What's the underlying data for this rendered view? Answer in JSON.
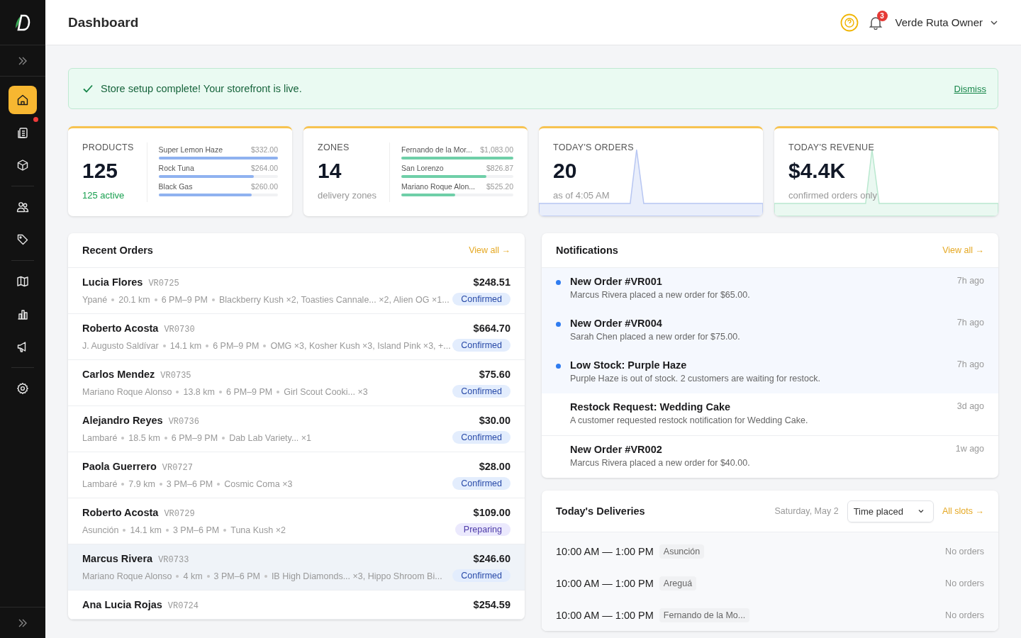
{
  "sidebar": {
    "items": [
      {
        "selected": true,
        "dot": false
      },
      {
        "selected": false,
        "dot": true
      },
      {
        "selected": false,
        "dot": false
      },
      {
        "selected": false,
        "dot": false
      },
      {
        "selected": false,
        "dot": false
      },
      {
        "selected": false,
        "dot": false
      },
      {
        "selected": false,
        "dot": false
      },
      {
        "selected": false,
        "dot": false
      },
      {
        "selected": false,
        "dot": false
      }
    ]
  },
  "header": {
    "title": "Dashboard",
    "notification_count": "3",
    "user": "Verde Ruta Owner"
  },
  "banner": {
    "message": "Store setup complete! Your storefront is live.",
    "action": "Dismiss"
  },
  "stats": [
    {
      "kind": "bars",
      "label": "PRODUCTS",
      "value": "125",
      "sub": "125 active",
      "sub_accent": true,
      "bars": [
        {
          "name": "Super Lemon Haze",
          "amount": "$332.00",
          "level": 1.0
        },
        {
          "name": "Rock Tuna",
          "amount": "$264.00",
          "level": 0.8
        },
        {
          "name": "Black Gas",
          "amount": "$260.00",
          "level": 0.78
        }
      ]
    },
    {
      "kind": "bars",
      "label": "ZONES",
      "value": "14",
      "sub": "delivery zones",
      "sub_accent": false,
      "bars": [
        {
          "name": "Fernando de la Mor...",
          "amount": "$1,083.00",
          "level": 1.0
        },
        {
          "name": "San Lorenzo",
          "amount": "$826.87",
          "level": 0.76
        },
        {
          "name": "Mariano Roque Alon...",
          "amount": "$525.20",
          "level": 0.48
        }
      ]
    },
    {
      "kind": "spark",
      "label": "TODAY'S ORDERS",
      "value": "20",
      "sub": "as of 4:05 AM",
      "sub_accent": false
    },
    {
      "kind": "spark",
      "label": "TODAY'S REVENUE",
      "value": "$4.4K",
      "sub": "confirmed orders only",
      "sub_accent": false
    }
  ],
  "recent_orders": {
    "title": "Recent Orders",
    "link": "View all →",
    "rows": [
      {
        "name": "Lucia Flores",
        "code": "VR0725",
        "amount": "$248.51",
        "status": "Confirmed",
        "kind": "confirmed",
        "highlighted": false,
        "meta": [
          "Ypané",
          "20.1 km",
          "6 PM–9 PM",
          "Blackberry Kush ×2, Toasties Cannale... ×2, Alien OG ×1..."
        ]
      },
      {
        "name": "Roberto Acosta",
        "code": "VR0730",
        "amount": "$664.70",
        "status": "Confirmed",
        "kind": "confirmed",
        "highlighted": false,
        "meta": [
          "J. Augusto Saldívar",
          "14.1 km",
          "6 PM–9 PM",
          "OMG ×3, Kosher Kush ×3, Island Pink ×3, +..."
        ]
      },
      {
        "name": "Carlos Mendez",
        "code": "VR0735",
        "amount": "$75.60",
        "status": "Confirmed",
        "kind": "confirmed",
        "highlighted": false,
        "meta": [
          "Mariano Roque Alonso",
          "13.8 km",
          "6 PM–9 PM",
          "Girl Scout Cooki... ×3"
        ]
      },
      {
        "name": "Alejandro Reyes",
        "code": "VR0736",
        "amount": "$30.00",
        "status": "Confirmed",
        "kind": "confirmed",
        "highlighted": false,
        "meta": [
          "Lambaré",
          "18.5 km",
          "6 PM–9 PM",
          "Dab Lab Variety... ×1"
        ]
      },
      {
        "name": "Paola Guerrero",
        "code": "VR0727",
        "amount": "$28.00",
        "status": "Confirmed",
        "kind": "confirmed",
        "highlighted": false,
        "meta": [
          "Lambaré",
          "7.9 km",
          "3 PM–6 PM",
          "Cosmic Coma ×3"
        ]
      },
      {
        "name": "Roberto Acosta",
        "code": "VR0729",
        "amount": "$109.00",
        "status": "Preparing",
        "kind": "preparing",
        "highlighted": false,
        "meta": [
          "Asunción",
          "14.1 km",
          "3 PM–6 PM",
          "Tuna Kush ×2"
        ]
      },
      {
        "name": "Marcus Rivera",
        "code": "VR0733",
        "amount": "$246.60",
        "status": "Confirmed",
        "kind": "confirmed",
        "highlighted": true,
        "meta": [
          "Mariano Roque Alonso",
          "4 km",
          "3 PM–6 PM",
          "IB High Diamonds... ×3, Hippo Shroom Bi..."
        ]
      },
      {
        "name": "Ana Lucia Rojas",
        "code": "VR0724",
        "amount": "$254.59",
        "highlighted": false
      }
    ]
  },
  "notifications": {
    "title": "Notifications",
    "link": "View all →",
    "items": [
      {
        "title": "New Order #VR001",
        "body": "Marcus Rivera placed a new order for $65.00.",
        "time": "7h ago",
        "unread": true
      },
      {
        "title": "New Order #VR004",
        "body": "Sarah Chen placed a new order for $75.00.",
        "time": "7h ago",
        "unread": true
      },
      {
        "title": "Low Stock: Purple Haze",
        "body": "Purple Haze is out of stock. 2 customers are waiting for restock.",
        "time": "7h ago",
        "unread": true
      },
      {
        "title": "Restock Request: Wedding Cake",
        "body": "A customer requested restock notification for Wedding Cake.",
        "time": "3d ago",
        "unread": false
      },
      {
        "title": "New Order #VR002",
        "body": "Marcus Rivera placed a new order for $40.00.",
        "time": "1w ago",
        "unread": false
      }
    ]
  },
  "deliveries": {
    "title": "Today's Deliveries",
    "date": "Saturday, May 2",
    "sort": "Time placed",
    "link": "All slots →",
    "rows": [
      {
        "slot": "10:00 AM — 1:00 PM",
        "zone": "Asunción",
        "orders": "No orders"
      },
      {
        "slot": "10:00 AM — 1:00 PM",
        "zone": "Areguá",
        "orders": "No orders"
      },
      {
        "slot": "10:00 AM — 1:00 PM",
        "zone": "Fernando de la Mo...",
        "orders": "No orders"
      }
    ]
  }
}
